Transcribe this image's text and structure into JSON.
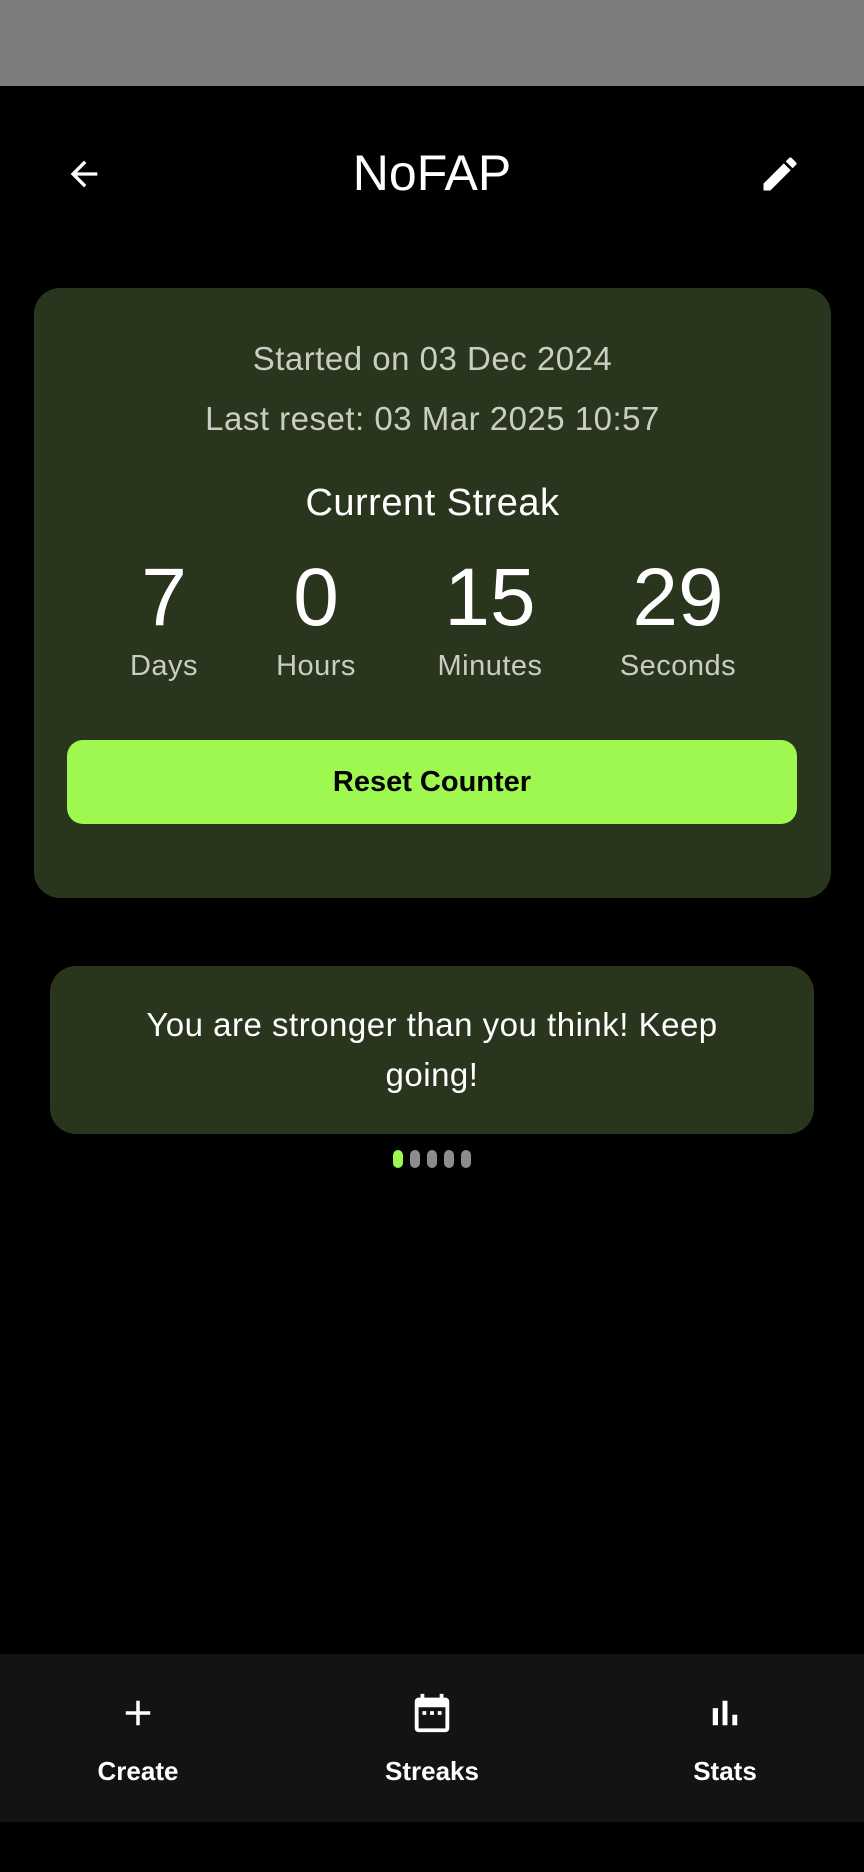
{
  "header": {
    "title": "NoFAP",
    "back_icon": "arrow-left-icon",
    "edit_icon": "pencil-icon"
  },
  "counter_card": {
    "started_text": "Started on 03 Dec 2024",
    "last_reset_text": "Last reset: 03 Mar 2025 10:57",
    "streak_title": "Current Streak",
    "units": [
      {
        "value": "7",
        "label": "Days"
      },
      {
        "value": "0",
        "label": "Hours"
      },
      {
        "value": "15",
        "label": "Minutes"
      },
      {
        "value": "29",
        "label": "Seconds"
      }
    ],
    "reset_label": "Reset Counter"
  },
  "quote": {
    "text": "You are stronger than you think! Keep going!",
    "page_count": 5,
    "active_page": 1
  },
  "bottom_nav": {
    "items": [
      {
        "label": "Create",
        "icon": "plus-icon"
      },
      {
        "label": "Streaks",
        "icon": "calendar-icon"
      },
      {
        "label": "Stats",
        "icon": "bar-chart-icon"
      }
    ]
  },
  "colors": {
    "accent": "#9ef84f",
    "card_background": "#2a351e",
    "background": "#000000",
    "nav_background": "#131313"
  }
}
